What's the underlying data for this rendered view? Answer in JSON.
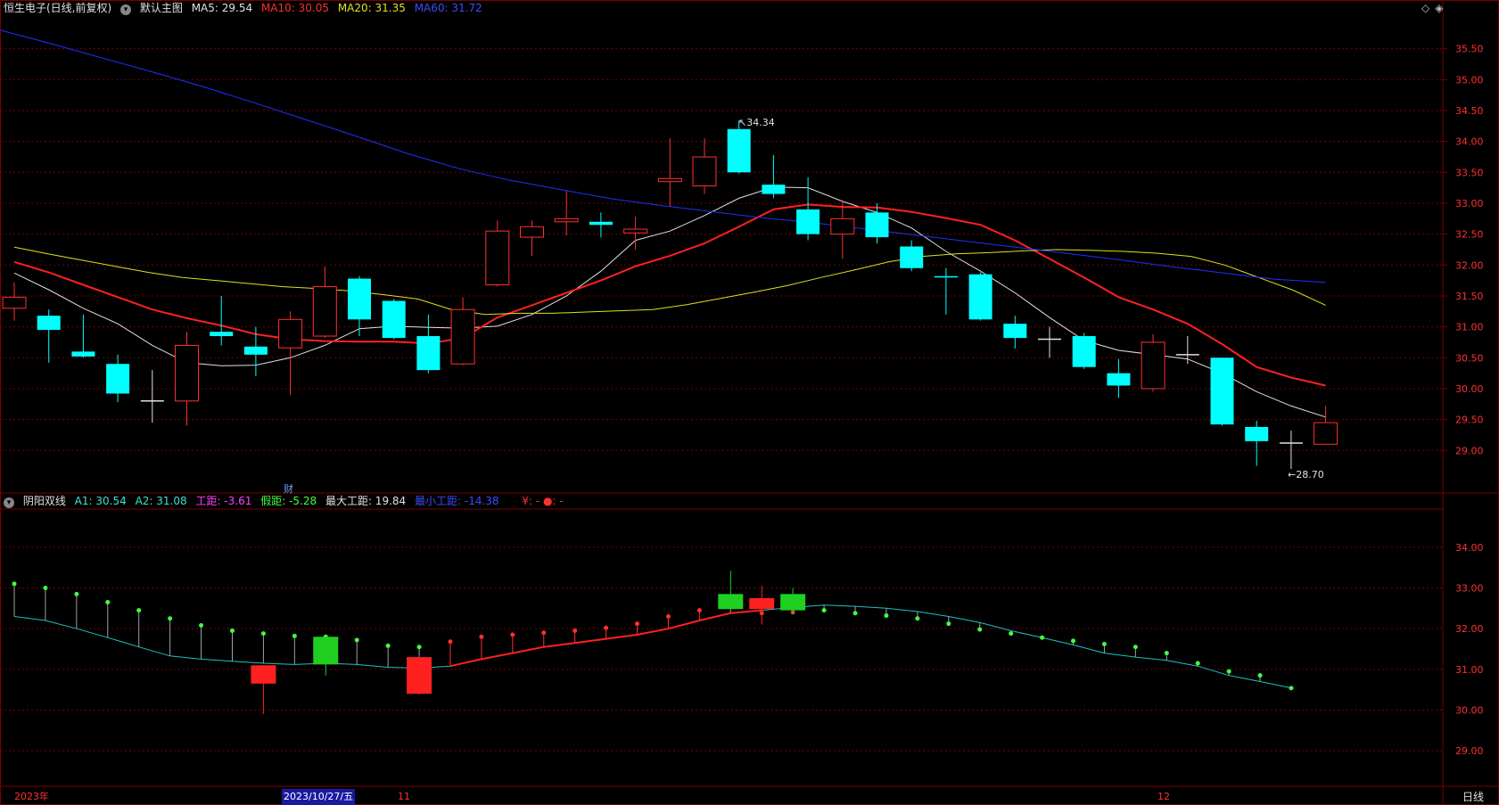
{
  "main_panel": {
    "stock_title": "恒生电子(日线,前复权)",
    "menu_label": "默认主图",
    "ma5_label": "MA5: 29.54",
    "ma10_label": "MA10: 30.05",
    "ma20_label": "MA20: 31.35",
    "ma60_label": "MA60: 31.72",
    "high_annotation": "34.34",
    "low_annotation": "28.70",
    "finance_marker": "财"
  },
  "indicator_panel": {
    "name": "阴阳双线",
    "a1_label": "A1: 30.54",
    "a2_label": "A2: 31.08",
    "gongju_label": "工距: -3.61",
    "jiaju_label": "假距: -5.28",
    "max_gongju_label": "最大工距: 19.84",
    "min_gongju_label": "最小工距: -14.38",
    "misc_label": "¥: -  ●: -"
  },
  "time_axis": {
    "year_label": "2023年",
    "cursor_date": "2023/10/27/五",
    "month_11": "11",
    "month_12": "12",
    "period_button": "日线"
  },
  "colors": {
    "up": "#ff3030",
    "down": "#00ffff",
    "ma5": "#e0e0e0",
    "ma10": "#ff2020",
    "ma20": "#e0e020",
    "ma60": "#2030ff",
    "grid": "#7a0000"
  },
  "chart_data": [
    {
      "type": "candlestick",
      "name": "恒生电子",
      "y_ticks": [
        "35.50",
        "35.00",
        "34.50",
        "34.00",
        "33.50",
        "33.00",
        "32.50",
        "32.00",
        "31.50",
        "31.00",
        "30.50",
        "30.00",
        "29.50",
        "29.00"
      ],
      "ylim": [
        28.6,
        36.0
      ],
      "candles": [
        {
          "o": 31.3,
          "c": 31.48,
          "h": 31.72,
          "l": 31.1
        },
        {
          "o": 31.18,
          "c": 30.95,
          "h": 31.28,
          "l": 30.42
        },
        {
          "o": 30.6,
          "c": 30.52,
          "h": 31.2,
          "l": 30.5
        },
        {
          "o": 30.4,
          "c": 29.92,
          "h": 30.55,
          "l": 29.78
        },
        {
          "o": 29.8,
          "c": 29.8,
          "h": 30.3,
          "l": 29.45
        },
        {
          "o": 29.8,
          "c": 30.7,
          "h": 30.92,
          "l": 29.4
        },
        {
          "o": 30.92,
          "c": 30.85,
          "h": 31.5,
          "l": 30.7
        },
        {
          "o": 30.68,
          "c": 30.55,
          "h": 31.0,
          "l": 30.2
        },
        {
          "o": 30.66,
          "c": 31.12,
          "h": 31.25,
          "l": 29.9
        },
        {
          "o": 30.85,
          "c": 31.65,
          "h": 31.98,
          "l": 30.82
        },
        {
          "o": 31.78,
          "c": 31.12,
          "h": 31.82,
          "l": 30.85
        },
        {
          "o": 31.42,
          "c": 30.82,
          "h": 31.45,
          "l": 30.8
        },
        {
          "o": 30.85,
          "c": 30.3,
          "h": 31.2,
          "l": 30.25
        },
        {
          "o": 30.4,
          "c": 31.28,
          "h": 31.48,
          "l": 30.38
        },
        {
          "o": 31.68,
          "c": 32.55,
          "h": 32.72,
          "l": 31.65
        },
        {
          "o": 32.45,
          "c": 32.62,
          "h": 32.72,
          "l": 32.15
        },
        {
          "o": 32.7,
          "c": 32.75,
          "h": 33.2,
          "l": 32.48
        },
        {
          "o": 32.7,
          "c": 32.65,
          "h": 32.85,
          "l": 32.45
        },
        {
          "o": 32.52,
          "c": 32.58,
          "h": 32.78,
          "l": 32.25
        },
        {
          "o": 33.35,
          "c": 33.4,
          "h": 34.05,
          "l": 32.95
        },
        {
          "o": 33.28,
          "c": 33.75,
          "h": 34.05,
          "l": 33.15
        },
        {
          "o": 34.2,
          "c": 33.5,
          "h": 34.34,
          "l": 33.48
        },
        {
          "o": 33.3,
          "c": 33.15,
          "h": 33.78,
          "l": 33.08
        },
        {
          "o": 32.9,
          "c": 32.5,
          "h": 33.42,
          "l": 32.4
        },
        {
          "o": 32.5,
          "c": 32.75,
          "h": 33.05,
          "l": 32.1
        },
        {
          "o": 32.85,
          "c": 32.45,
          "h": 33.0,
          "l": 32.35
        },
        {
          "o": 32.3,
          "c": 31.95,
          "h": 32.4,
          "l": 31.9
        },
        {
          "o": 31.82,
          "c": 31.8,
          "h": 31.95,
          "l": 31.2
        },
        {
          "o": 31.85,
          "c": 31.12,
          "h": 31.88,
          "l": 31.1
        },
        {
          "o": 31.05,
          "c": 30.82,
          "h": 31.18,
          "l": 30.65
        },
        {
          "o": 30.8,
          "c": 30.8,
          "h": 31.0,
          "l": 30.5
        },
        {
          "o": 30.85,
          "c": 30.35,
          "h": 30.9,
          "l": 30.32
        },
        {
          "o": 30.25,
          "c": 30.05,
          "h": 30.48,
          "l": 29.85
        },
        {
          "o": 30.0,
          "c": 30.75,
          "h": 30.88,
          "l": 29.95
        },
        {
          "o": 30.55,
          "c": 30.55,
          "h": 30.85,
          "l": 30.4
        },
        {
          "o": 30.5,
          "c": 29.42,
          "h": 30.5,
          "l": 29.4
        },
        {
          "o": 29.38,
          "c": 29.15,
          "h": 29.48,
          "l": 28.75
        },
        {
          "o": 29.12,
          "c": 29.12,
          "h": 29.32,
          "l": 28.7
        },
        {
          "o": 29.1,
          "c": 29.45,
          "h": 29.72,
          "l": 29.1
        }
      ],
      "series": [
        {
          "name": "MA5",
          "values": [
            31.87,
            31.6,
            31.3,
            31.05,
            30.7,
            30.42,
            30.37,
            30.38,
            30.5,
            30.7,
            30.97,
            31.01,
            30.99,
            30.98,
            31.01,
            31.2,
            31.5,
            31.9,
            32.4,
            32.55,
            32.8,
            33.08,
            33.26,
            33.25,
            33.03,
            32.85,
            32.6,
            32.22,
            31.9,
            31.55,
            31.15,
            30.78,
            30.62,
            30.55,
            30.48,
            30.25,
            29.95,
            29.72,
            29.54
          ]
        },
        {
          "name": "MA10",
          "values": [
            32.05,
            31.88,
            31.68,
            31.48,
            31.28,
            31.14,
            31.02,
            30.88,
            30.8,
            30.77,
            30.76,
            30.76,
            30.73,
            30.82,
            31.15,
            31.35,
            31.55,
            31.75,
            31.98,
            32.15,
            32.35,
            32.62,
            32.9,
            32.98,
            32.94,
            32.93,
            32.86,
            32.76,
            32.65,
            32.4,
            32.1,
            31.8,
            31.48,
            31.28,
            31.05,
            30.72,
            30.35,
            30.18,
            30.05
          ]
        },
        {
          "name": "MA20",
          "values": [
            32.29,
            32.18,
            32.08,
            31.98,
            31.88,
            31.8,
            31.75,
            31.7,
            31.65,
            31.62,
            31.58,
            31.52,
            31.45,
            31.28,
            31.2,
            31.22,
            31.22,
            31.24,
            31.26,
            31.28,
            31.36,
            31.46,
            31.56,
            31.67,
            31.8,
            31.92,
            32.05,
            32.14,
            32.18,
            32.2,
            32.23,
            32.25,
            32.24,
            32.22,
            32.19,
            32.14,
            32.0,
            31.8,
            31.6,
            31.35
          ]
        },
        {
          "name": "MA60",
          "values": [
            35.8,
            35.58,
            35.35,
            35.12,
            34.88,
            34.62,
            34.35,
            34.08,
            33.8,
            33.56,
            33.37,
            33.22,
            33.07,
            32.96,
            32.86,
            32.76,
            32.68,
            32.58,
            32.48,
            32.38,
            32.28,
            32.18,
            32.08,
            31.97,
            31.87,
            31.77,
            31.72
          ]
        }
      ]
    },
    {
      "type": "line",
      "name": "阴阳双线",
      "y_ticks": [
        "34.00",
        "33.00",
        "32.00",
        "31.00",
        "30.00",
        "29.00"
      ],
      "ylim": [
        28.5,
        34.5
      ],
      "series": [
        {
          "name": "A2",
          "values": [
            32.3,
            32.2,
            32.0,
            31.78,
            31.55,
            31.33,
            31.25,
            31.2,
            31.15,
            31.12,
            31.15,
            31.12,
            31.05,
            31.03,
            31.08,
            31.25,
            31.4,
            31.55,
            31.65,
            31.75,
            31.85,
            32.0,
            32.2,
            32.38,
            32.45,
            32.52,
            32.58,
            32.55,
            32.5,
            32.42,
            32.3,
            32.15,
            31.95,
            31.78,
            31.6,
            31.4,
            31.3,
            31.22,
            31.08,
            30.85,
            30.7,
            30.54
          ]
        },
        {
          "name": "A1",
          "values": [
            33.1,
            33.0,
            32.85,
            32.65,
            32.45,
            32.25,
            32.08,
            31.95,
            31.88,
            31.82,
            31.8,
            31.72,
            31.58,
            31.55,
            31.68,
            31.8,
            31.85,
            31.9,
            31.95,
            32.02,
            32.12,
            32.3,
            32.45,
            32.55,
            32.38,
            32.4,
            32.45,
            32.38,
            32.32,
            32.25,
            32.12,
            31.98,
            31.88,
            31.78,
            31.7,
            31.62,
            31.55,
            31.4,
            31.15,
            30.95,
            30.85,
            30.54
          ]
        }
      ]
    }
  ]
}
